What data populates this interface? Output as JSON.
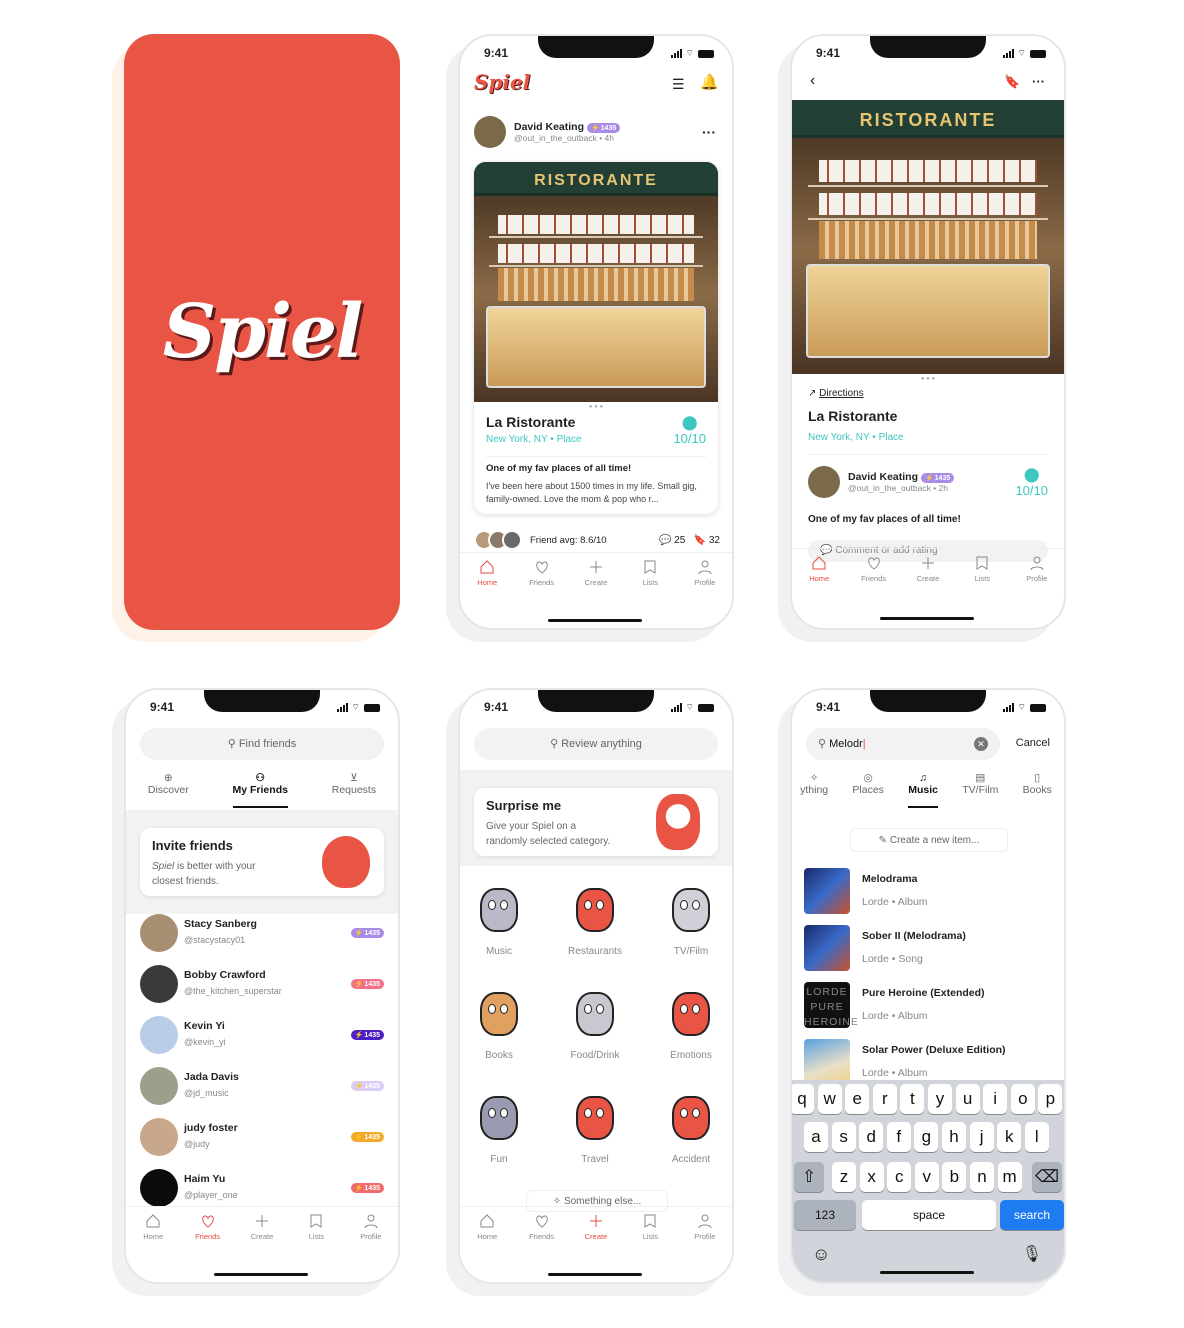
{
  "brand": {
    "name": "Spiel",
    "splash_color": "#e85545"
  },
  "status": {
    "time": "9:41"
  },
  "tabs": [
    "Home",
    "Friends",
    "Create",
    "Lists",
    "Profile"
  ],
  "feed": {
    "author": "David Keating",
    "badge": "1435",
    "handle": "@out_in_the_outback",
    "age": "4h",
    "sign": "RISTORANTE",
    "place": "La Ristorante",
    "place_meta": "New York, NY • Place",
    "rating": "10/10",
    "review_title": "One of my fav places of all time!",
    "review_body": "I've been here about 1500 times in my life. Small gig, family-owned. Love the mom & pop who r...",
    "friend_avg": "Friend avg: 8.6/10",
    "comments": "25",
    "saves": "32"
  },
  "detail": {
    "sign": "RISTORANTE",
    "directions": "Directions",
    "place": "La Ristorante",
    "place_meta": "New York, NY • Place",
    "author": "David Keating",
    "badge": "1435",
    "handle": "@out_in_the_outback",
    "age": "2h",
    "rating": "10/10",
    "review_title": "One of my fav places of all time!",
    "comment_placeholder": "Comment or add rating"
  },
  "friends": {
    "search_placeholder": "Find friends",
    "segments": [
      "Discover",
      "My Friends",
      "Requests"
    ],
    "invite_title": "Invite friends",
    "invite_brand": "Spiel",
    "invite_body_1": " is better with your",
    "invite_body_2": "closest friends.",
    "list": [
      {
        "name": "Stacy Sanberg",
        "handle": "@stacystacy01",
        "badge": "1435",
        "color": "#a98be8"
      },
      {
        "name": "Bobby Crawford",
        "handle": "@the_kitchen_superstar",
        "badge": "1435",
        "color": "#f2708a"
      },
      {
        "name": "Kevin Yi",
        "handle": "@kevin_yi",
        "badge": "1435",
        "color": "#4b1fc4"
      },
      {
        "name": "Jada Davis",
        "handle": "@jd_music",
        "badge": "1435",
        "color": "#d9ccf5"
      },
      {
        "name": "judy foster",
        "handle": "@judy",
        "badge": "1435",
        "color": "#f5a92c"
      },
      {
        "name": "Haim Yu",
        "handle": "@player_one",
        "badge": "1435",
        "color": "#f06b6b"
      }
    ]
  },
  "create": {
    "search_placeholder": "Review anything",
    "surprise_title": "Surprise me",
    "surprise_body_1": "Give your Spiel on a",
    "surprise_body_2": "randomly selected category.",
    "categories": [
      "Music",
      "Restaurants",
      "TV/Film",
      "Books",
      "Food/Drink",
      "Emotions",
      "Fun",
      "Travel",
      "Accident"
    ],
    "else_label": "Something else..."
  },
  "search": {
    "query": "Melodr",
    "cancel": "Cancel",
    "filters": [
      "ything",
      "Places",
      "Music",
      "TV/Film",
      "Books"
    ],
    "create_new": "Create a new item...",
    "results": [
      {
        "title": "Melodrama",
        "meta": "Lorde • Album"
      },
      {
        "title": "Sober II (Melodrama)",
        "meta": "Lorde • Song"
      },
      {
        "title": "Pure Heroine (Extended)",
        "meta": "Lorde • Album"
      },
      {
        "title": "Solar Power (Deluxe Edition)",
        "meta": "Lorde • Album"
      }
    ],
    "pure_heroine_art": "LORDE PURE HEROINE",
    "keyboard": {
      "row1": [
        "q",
        "w",
        "e",
        "r",
        "t",
        "y",
        "u",
        "i",
        "o",
        "p"
      ],
      "row2": [
        "a",
        "s",
        "d",
        "f",
        "g",
        "h",
        "j",
        "k",
        "l"
      ],
      "row3": [
        "z",
        "x",
        "c",
        "v",
        "b",
        "n",
        "m"
      ],
      "num": "123",
      "space": "space",
      "search": "search"
    }
  }
}
